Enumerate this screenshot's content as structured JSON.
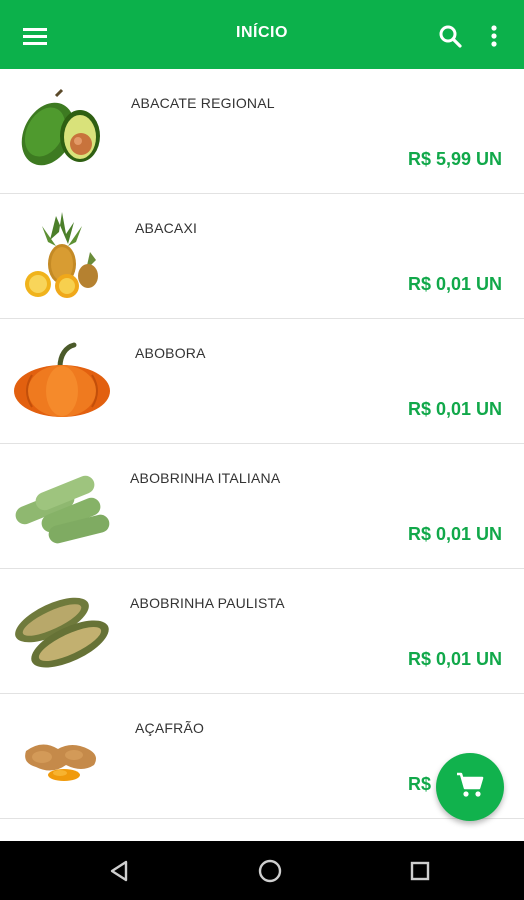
{
  "appbar": {
    "title": "INÍCIO",
    "menu_icon": "hamburger-menu-icon",
    "search_icon": "search-icon",
    "more_icon": "more-vert-icon"
  },
  "products": [
    {
      "name": "ABACATE REGIONAL",
      "price": "R$ 5,99 UN",
      "image": "avocado"
    },
    {
      "name": "ABACAXI",
      "price": "R$ 0,01 UN",
      "image": "pineapple"
    },
    {
      "name": "ABOBORA",
      "price": "R$ 0,01 UN",
      "image": "pumpkin"
    },
    {
      "name": "ABOBRINHA ITALIANA",
      "price": "R$ 0,01 UN",
      "image": "zucchini"
    },
    {
      "name": "ABOBRINHA PAULISTA",
      "price": "R$ 0,01 UN",
      "image": "striped-squash"
    },
    {
      "name": "AÇAFRÃO",
      "price": "R$ 0,01 UN",
      "image": "turmeric"
    }
  ],
  "fab": {
    "icon": "shopping-cart-icon"
  },
  "navbar": {
    "back_icon": "back-triangle-icon",
    "home_icon": "home-circle-icon",
    "recents_icon": "recents-square-icon"
  },
  "colors": {
    "primary": "#0cb14b",
    "price": "#11a84a",
    "fab": "#11b24d"
  }
}
